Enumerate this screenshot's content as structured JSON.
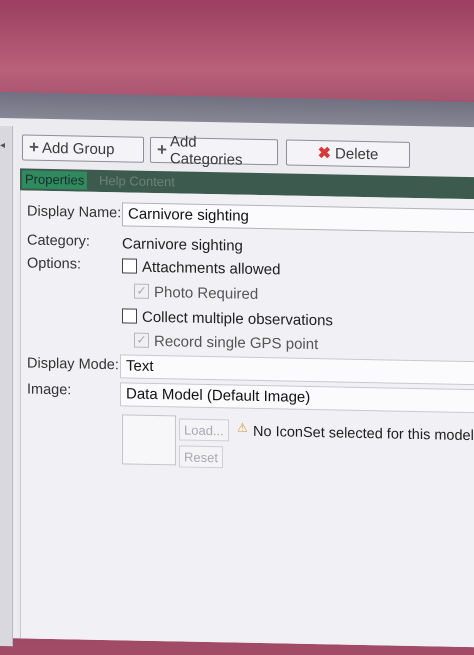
{
  "toolbar": {
    "add_group": "Add Group",
    "add_categories": "Add Categories",
    "delete": "Delete"
  },
  "tabs": [
    {
      "label": "Properties",
      "active": true
    },
    {
      "label": "Help Content",
      "active": false
    }
  ],
  "form": {
    "display_name_label": "Display Name:",
    "display_name_value": "Carnivore sighting",
    "category_label": "Category:",
    "category_value": "Carnivore sighting",
    "options_label": "Options:",
    "options": [
      {
        "label": "Attachments allowed",
        "checked": false,
        "enabled": true
      },
      {
        "label": "Photo Required",
        "checked": true,
        "enabled": false
      },
      {
        "label": "Collect multiple observations",
        "checked": false,
        "enabled": true
      },
      {
        "label": "Record single GPS point",
        "checked": true,
        "enabled": false
      }
    ],
    "display_mode_label": "Display Mode:",
    "display_mode_value": "Text",
    "image_label": "Image:",
    "image_value": "Data Model (Default Image)",
    "load_button": "Load...",
    "reset_button": "Reset",
    "warning_text": "No IconSet selected for this model."
  },
  "colors": {
    "tab_active": "#2f8a5f",
    "delete_icon": "#d63a3a",
    "warning_icon": "#d2a13b"
  }
}
